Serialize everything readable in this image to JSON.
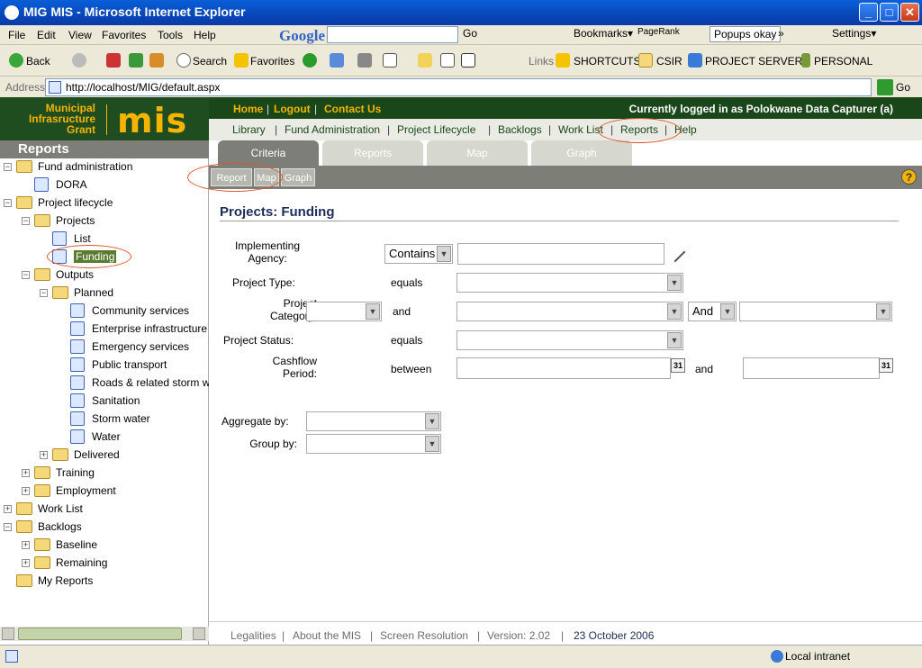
{
  "window": {
    "title": "MIG MIS - Microsoft Internet Explorer",
    "min": "_",
    "max": "□",
    "close": "✕"
  },
  "menu": [
    "File",
    "Edit",
    "View",
    "Favorites",
    "Tools",
    "Help"
  ],
  "google_bar": {
    "logo": "Google",
    "go": "Go",
    "bookmarks": "Bookmarks▾",
    "pagerank": "PageRank",
    "popups": "Popups okay",
    "settings": "Settings▾",
    "more": "»"
  },
  "toolbar": {
    "back": "Back",
    "search": "Search",
    "favorites": "Favorites",
    "links": "Links",
    "link1": "SHORTCUTS",
    "link2": "CSIR",
    "link3": "PROJECT SERVERS",
    "link4": "PERSONAL"
  },
  "address": {
    "label": "Address",
    "url": "http://localhost/MIG/default.aspx",
    "go": "Go"
  },
  "header": {
    "logo_line1": "Municipal",
    "logo_line2": "Infrasructure",
    "logo_line3": "Grant",
    "logo_mis": "mis",
    "top_links": [
      "Home",
      "Logout",
      "Contact Us"
    ],
    "user": "Currently logged in as  Polokwane Data Capturer (a)",
    "nav": [
      "Library",
      "Fund Administration",
      "Project Lifecycle",
      "Backlogs",
      "Work List",
      "Reports",
      "Help"
    ]
  },
  "sidebar": {
    "title": "Reports",
    "tree": [
      "Fund administration",
      "DORA",
      "Project lifecycle",
      "Projects",
      "List",
      "Funding",
      "Outputs",
      "Planned",
      "Community services",
      "Enterprise infrastructure",
      "Emergency services",
      "Public transport",
      "Roads & related storm wat",
      "Sanitation",
      "Storm water",
      "Water",
      "Delivered",
      "Training",
      "Employment",
      "Work List",
      "Backlogs",
      "Baseline",
      "Remaining",
      "My Reports"
    ]
  },
  "tabs": [
    "Criteria",
    "Reports",
    "Map",
    "Graph"
  ],
  "subtabs": [
    "Report",
    "Map",
    "Graph"
  ],
  "form": {
    "title": "Projects: Funding",
    "implementing_agency_label": "Implementing Agency:",
    "implementing_agency_op": "Contains",
    "project_type_label": "Project Type:",
    "project_type_op": "equals",
    "project_category_label": "Project Category:",
    "project_category_op": "and",
    "and_select": "And",
    "project_status_label": "Project Status:",
    "project_status_op": "equals",
    "cashflow_label": "Cashflow Period:",
    "cashflow_op": "between",
    "cashflow_and": "and",
    "calendar_day": "31",
    "aggregate_label": "Aggregate by:",
    "group_label": "Group by:"
  },
  "footer": {
    "links": [
      "Legalities",
      "About the MIS",
      "Screen Resolution",
      "Version: 2.02"
    ],
    "date": "23 October 2006"
  },
  "status": {
    "zone": "Local intranet"
  },
  "colors": {
    "header_green": "#1f4d1f",
    "logo_gold": "#f4b400",
    "tab_gray": "#7d7e77",
    "annotation": "#e0552b"
  }
}
